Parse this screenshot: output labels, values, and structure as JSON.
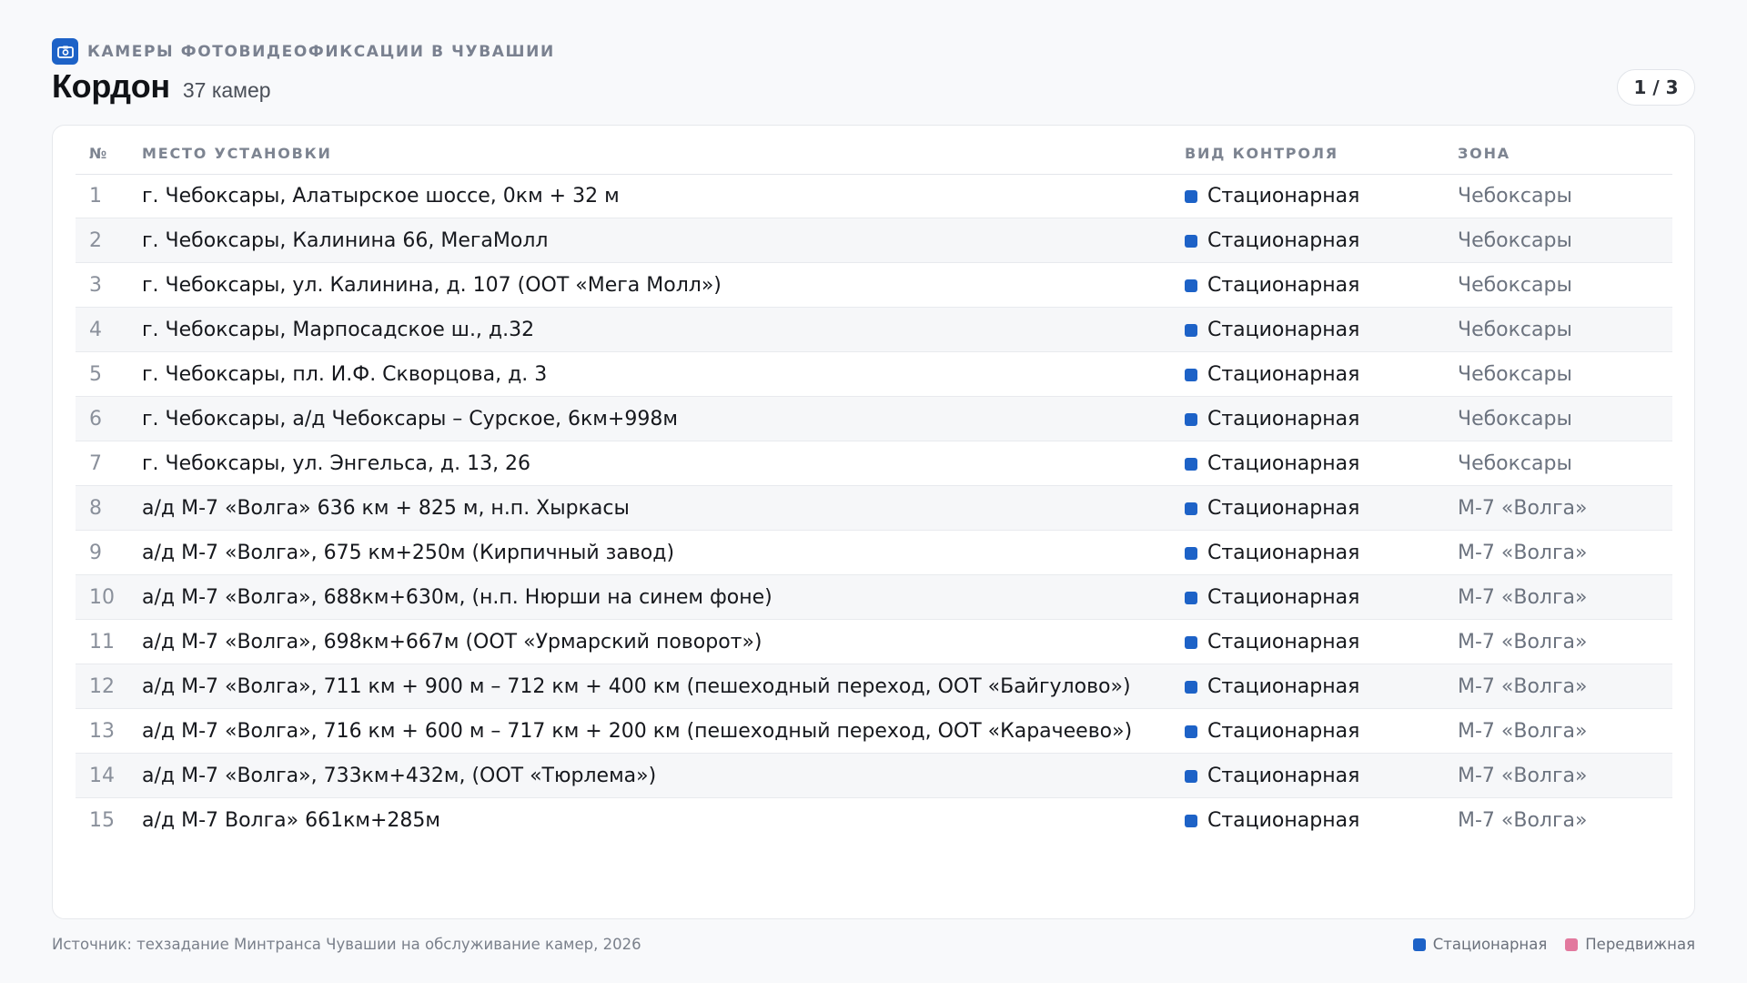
{
  "header": {
    "eyebrow": "КАМЕРЫ ФОТОВИДЕОФИКСАЦИИ В ЧУВАШИИ",
    "icon": "camera-icon",
    "title": "Кордон",
    "count": "37 камер",
    "pager": "1 / 3"
  },
  "table": {
    "columns": {
      "num": "№",
      "place": "МЕСТО УСТАНОВКИ",
      "type": "ВИД КОНТРОЛЯ",
      "zone": "ЗОНА"
    },
    "rows": [
      {
        "num": "1",
        "place": "г. Чебоксары, Алатырское шоссе, 0км + 32 м",
        "type": "Стационарная",
        "zone": "Чебоксары"
      },
      {
        "num": "2",
        "place": "г. Чебоксары, Калинина 66, МегаМолл",
        "type": "Стационарная",
        "zone": "Чебоксары"
      },
      {
        "num": "3",
        "place": "г. Чебоксары, ул. Калинина, д. 107 (ООТ «Мега Молл»)",
        "type": "Стационарная",
        "zone": "Чебоксары"
      },
      {
        "num": "4",
        "place": "г. Чебоксары, Марпосадское ш., д.32",
        "type": "Стационарная",
        "zone": "Чебоксары"
      },
      {
        "num": "5",
        "place": "г. Чебоксары, пл. И.Ф. Скворцова, д. 3",
        "type": "Стационарная",
        "zone": "Чебоксары"
      },
      {
        "num": "6",
        "place": "г. Чебоксары, а/д Чебоксары – Сурское, 6км+998м",
        "type": "Стационарная",
        "zone": "Чебоксары"
      },
      {
        "num": "7",
        "place": "г. Чебоксары, ул. Энгельса, д. 13, 26",
        "type": "Стационарная",
        "zone": "Чебоксары"
      },
      {
        "num": "8",
        "place": "а/д М-7 «Волга» 636 км + 825 м, н.п. Хыркасы",
        "type": "Стационарная",
        "zone": "М-7 «Волга»"
      },
      {
        "num": "9",
        "place": "а/д М-7 «Волга», 675 км+250м (Кирпичный завод)",
        "type": "Стационарная",
        "zone": "М-7 «Волга»"
      },
      {
        "num": "10",
        "place": "а/д М-7 «Волга», 688км+630м, (н.п. Нюрши на синем фоне)",
        "type": "Стационарная",
        "zone": "М-7 «Волга»"
      },
      {
        "num": "11",
        "place": "а/д М-7 «Волга», 698км+667м (ООТ «Урмарский поворот»)",
        "type": "Стационарная",
        "zone": "М-7 «Волга»"
      },
      {
        "num": "12",
        "place": "а/д М-7 «Волга», 711 км + 900 м – 712 км + 400 км (пешеходный переход, ООТ «Байгулово»)",
        "type": "Стационарная",
        "zone": "М-7 «Волга»"
      },
      {
        "num": "13",
        "place": "а/д М-7 «Волга», 716 км + 600 м – 717 км + 200 км (пешеходный переход, ООТ «Карачеево»)",
        "type": "Стационарная",
        "zone": "М-7 «Волга»"
      },
      {
        "num": "14",
        "place": "а/д М-7 «Волга», 733км+432м, (ООТ «Тюрлема»)",
        "type": "Стационарная",
        "zone": "М-7 «Волга»"
      },
      {
        "num": "15",
        "place": "а/д М-7 Волга» 661км+285м",
        "type": "Стационарная",
        "zone": "М-7 «Волга»"
      }
    ]
  },
  "footer": {
    "source": "Источник: техзадание Минтранса Чувашии на обслуживание камер, 2026",
    "legend": [
      {
        "label": "Стационарная",
        "color": "#1d62c7"
      },
      {
        "label": "Передвижная",
        "color": "#e2799e"
      }
    ]
  }
}
